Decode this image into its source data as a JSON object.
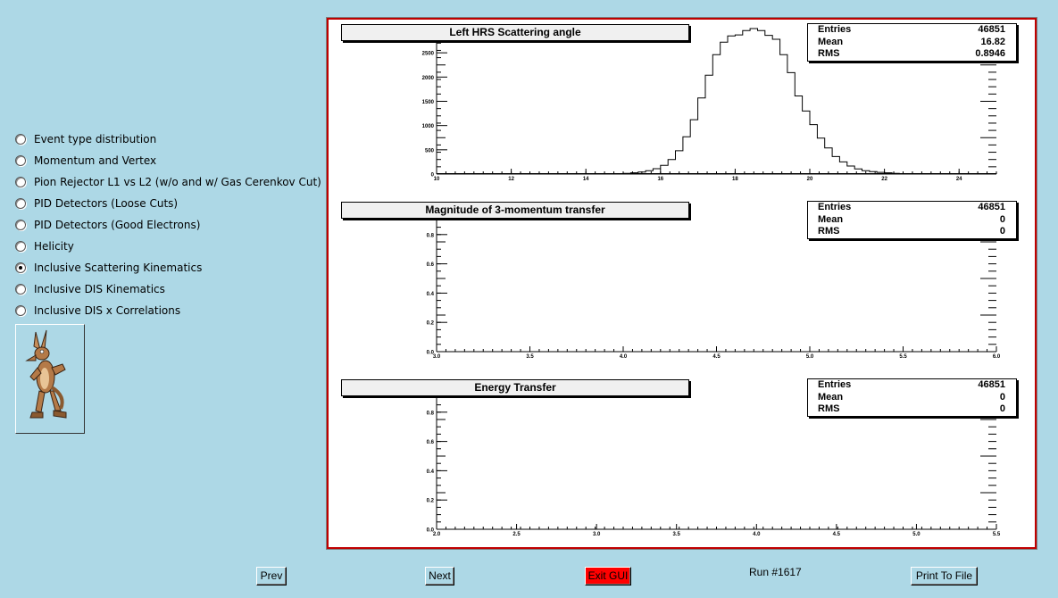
{
  "radio_options": [
    {
      "label": "Event type distribution",
      "selected": false
    },
    {
      "label": "Momentum and Vertex",
      "selected": false
    },
    {
      "label": "Pion Rejector L1 vs L2 (w/o and w/ Gas Cerenkov Cut)",
      "selected": false
    },
    {
      "label": "PID Detectors (Loose Cuts)",
      "selected": false
    },
    {
      "label": "PID Detectors (Good Electrons)",
      "selected": false
    },
    {
      "label": "Helicity",
      "selected": false
    },
    {
      "label": "Inclusive Scattering Kinematics",
      "selected": true
    },
    {
      "label": "Inclusive DIS Kinematics",
      "selected": false
    },
    {
      "label": "Inclusive DIS x Correlations",
      "selected": false
    }
  ],
  "logo_icon": "coyote-cartoon-icon",
  "stats_labels": {
    "entries": "Entries",
    "mean": "Mean",
    "rms": "RMS"
  },
  "plots": [
    {
      "title": "Left HRS Scattering angle",
      "entries": "46851",
      "mean": "16.82",
      "rms": "0.8946"
    },
    {
      "title": "Magnitude of 3-momentum transfer",
      "entries": "46851",
      "mean": "0",
      "rms": "0"
    },
    {
      "title": "Energy Transfer",
      "entries": "46851",
      "mean": "0",
      "rms": "0"
    }
  ],
  "chart_data": [
    {
      "type": "bar",
      "title": "Left HRS Scattering angle",
      "xlim": [
        10,
        25
      ],
      "ylim": [
        0,
        3000
      ],
      "x_ticks": [
        "10",
        "12",
        "14",
        "16",
        "18",
        "20",
        "22",
        "24"
      ],
      "y_ticks": [
        "0",
        "500",
        "1000",
        "1500",
        "2000",
        "2500"
      ],
      "bin_edges_start": 14.6,
      "bin_width": 0.2,
      "values": [
        5,
        10,
        15,
        25,
        40,
        70,
        110,
        180,
        300,
        480,
        770,
        1120,
        1570,
        2040,
        2460,
        2720,
        2850,
        2870,
        2960,
        3010,
        2960,
        2860,
        2780,
        2460,
        2090,
        1610,
        1300,
        1020,
        740,
        540,
        360,
        250,
        165,
        105,
        70,
        50,
        35,
        25,
        15,
        10
      ]
    },
    {
      "type": "bar",
      "title": "Magnitude of 3-momentum transfer",
      "xlim": [
        3,
        6
      ],
      "ylim": [
        0,
        1
      ],
      "x_ticks": [
        "3.0",
        "3.5",
        "4.0",
        "4.5",
        "5.0",
        "5.5",
        "6.0"
      ],
      "y_ticks": [
        "0.0",
        "0.2",
        "0.4",
        "0.6",
        "0.8"
      ],
      "values": []
    },
    {
      "type": "bar",
      "title": "Energy Transfer",
      "xlim": [
        2,
        5.5
      ],
      "ylim": [
        0,
        1
      ],
      "x_ticks": [
        "2.0",
        "2.5",
        "3.0",
        "3.5",
        "4.0",
        "4.5",
        "5.0",
        "5.5"
      ],
      "y_ticks": [
        "0.0",
        "0.2",
        "0.4",
        "0.6",
        "0.8"
      ],
      "values": []
    }
  ],
  "buttons": {
    "prev": "Prev",
    "next": "Next",
    "exit": "Exit GUI",
    "print": "Print To File"
  },
  "run_label": "Run #1617",
  "colors": {
    "background": "#add8e6",
    "frame": "#c00000",
    "exit_button": "#ff0000"
  }
}
